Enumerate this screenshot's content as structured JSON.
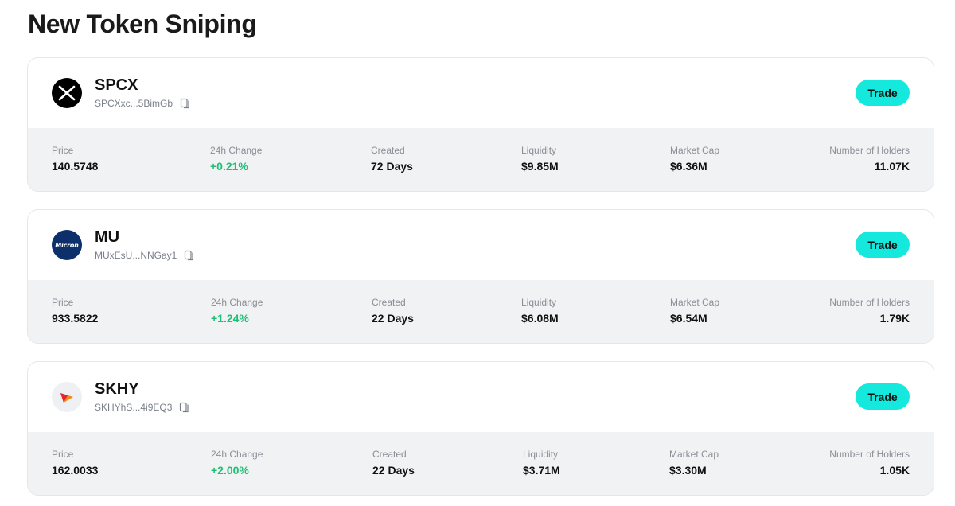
{
  "page": {
    "title": "New Token Sniping"
  },
  "tokens": [
    {
      "symbol": "SPCX",
      "address": "SPCXxc...5BimGb",
      "logo_icon": "x-logo-icon",
      "trade_label": "Trade",
      "stats": {
        "price_label": "Price",
        "price": "140.5748",
        "change_label": "24h Change",
        "change": "+0.21%",
        "created_label": "Created",
        "created": "72 Days",
        "liquidity_label": "Liquidity",
        "liquidity": "$9.85M",
        "mcap_label": "Market Cap",
        "mcap": "$6.36M",
        "holders_label": "Number of Holders",
        "holders": "11.07K"
      }
    },
    {
      "symbol": "MU",
      "address": "MUxEsU...NNGay1",
      "logo_icon": "micron-logo-icon",
      "logo_text": "Micron",
      "trade_label": "Trade",
      "stats": {
        "price_label": "Price",
        "price": "933.5822",
        "change_label": "24h Change",
        "change": "+1.24%",
        "created_label": "Created",
        "created": "22 Days",
        "liquidity_label": "Liquidity",
        "liquidity": "$6.08M",
        "mcap_label": "Market Cap",
        "mcap": "$6.54M",
        "holders_label": "Number of Holders",
        "holders": "1.79K"
      }
    },
    {
      "symbol": "SKHY",
      "address": "SKHYhS...4i9EQ3",
      "logo_icon": "sk-hynix-logo-icon",
      "trade_label": "Trade",
      "stats": {
        "price_label": "Price",
        "price": "162.0033",
        "change_label": "24h Change",
        "change": "+2.00%",
        "created_label": "Created",
        "created": "22 Days",
        "liquidity_label": "Liquidity",
        "liquidity": "$3.71M",
        "mcap_label": "Market Cap",
        "mcap": "$3.30M",
        "holders_label": "Number of Holders",
        "holders": "1.05K"
      }
    }
  ],
  "colors": {
    "trade_button": "#15e8dd",
    "positive_change": "#1fbf76",
    "stats_background": "#f1f2f4"
  }
}
